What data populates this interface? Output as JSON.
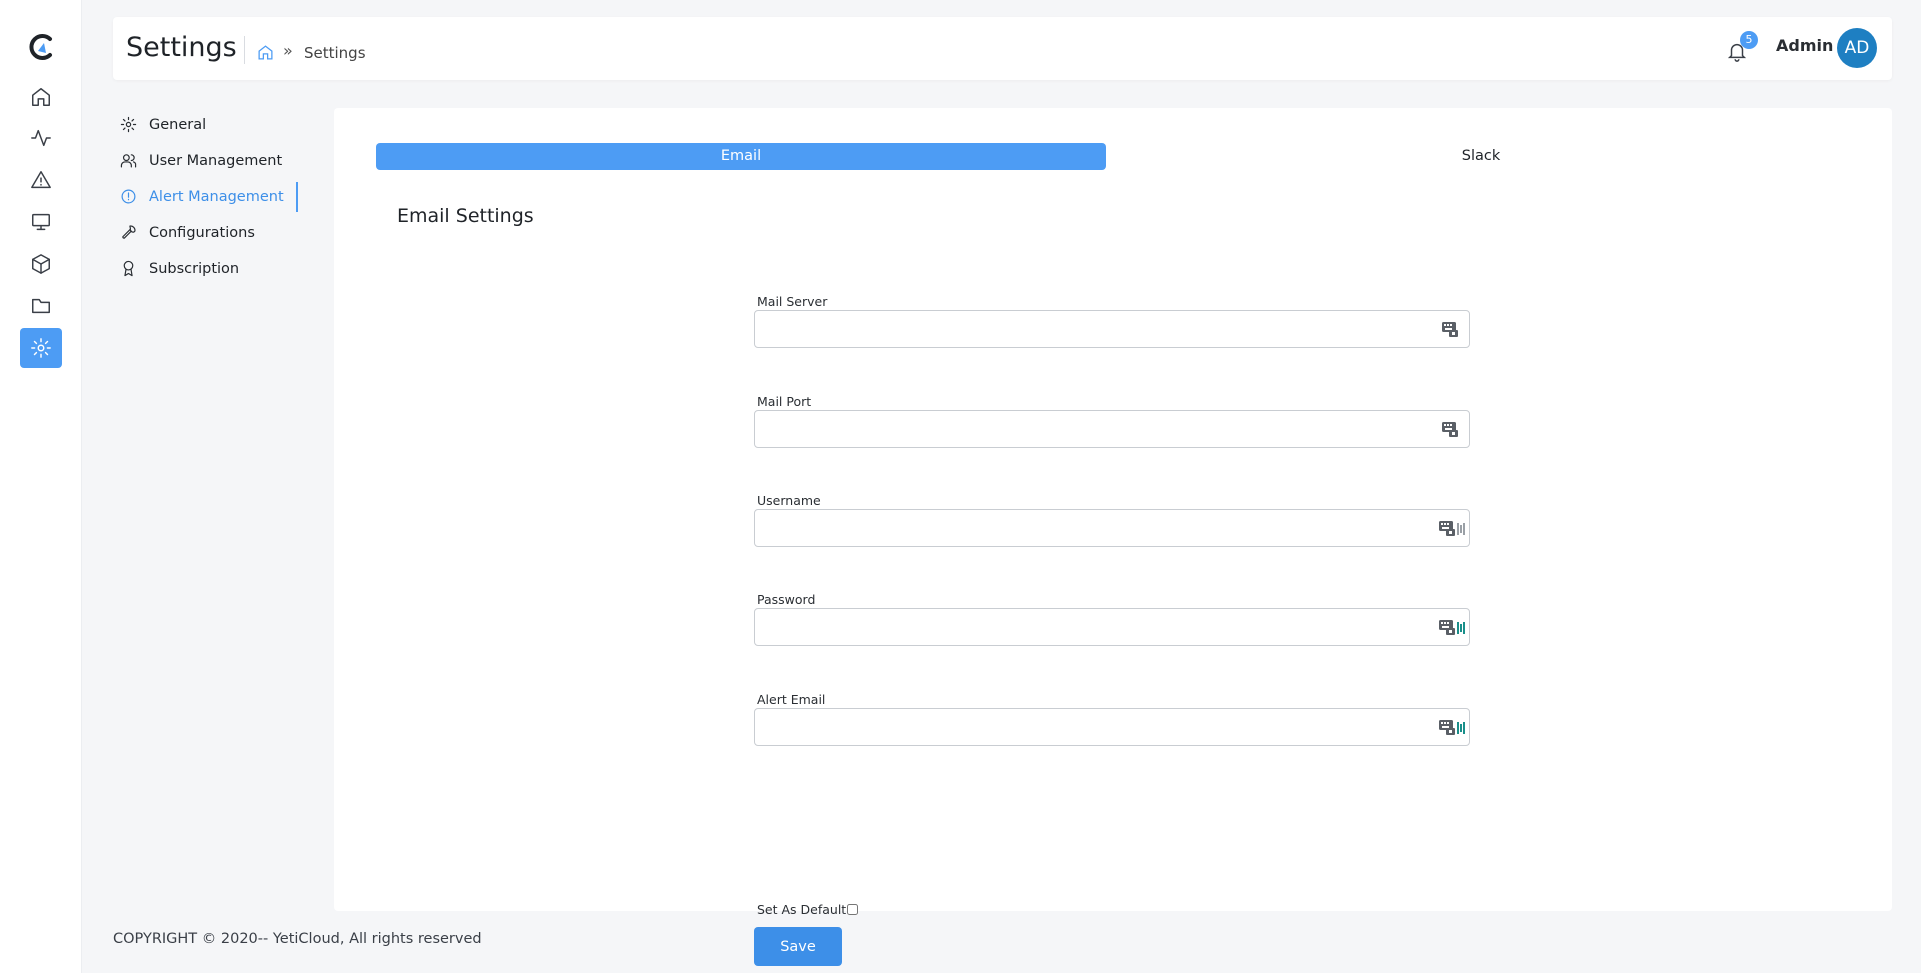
{
  "header": {
    "title": "Settings",
    "breadcrumb_sep": "»",
    "breadcrumb_current": "Settings",
    "notification_count": "5",
    "user_name": "Admin",
    "avatar_initials": "AD"
  },
  "rail": {
    "items": [
      {
        "icon": "home-icon"
      },
      {
        "icon": "activity-icon"
      },
      {
        "icon": "alert-triangle-icon"
      },
      {
        "icon": "monitor-icon"
      },
      {
        "icon": "box-icon"
      },
      {
        "icon": "folder-icon"
      },
      {
        "icon": "settings-icon",
        "active": true
      }
    ]
  },
  "subnav": {
    "items": [
      {
        "label": "General",
        "icon": "gear-icon"
      },
      {
        "label": "User Management",
        "icon": "users-icon"
      },
      {
        "label": "Alert Management",
        "icon": "alert-circle-icon",
        "active": true
      },
      {
        "label": "Configurations",
        "icon": "wrench-icon"
      },
      {
        "label": "Subscription",
        "icon": "award-icon"
      }
    ]
  },
  "tabs": [
    {
      "label": "Email",
      "active": true
    },
    {
      "label": "Slack",
      "active": false
    }
  ],
  "section_title": "Email Settings",
  "form": {
    "fields": [
      {
        "label": "Mail Server",
        "value": ""
      },
      {
        "label": "Mail Port",
        "value": ""
      },
      {
        "label": "Username",
        "value": ""
      },
      {
        "label": "Password",
        "value": ""
      },
      {
        "label": "Alert Email",
        "value": ""
      }
    ],
    "default_label": "Set As Default",
    "save_label": "Save"
  },
  "footer": {
    "copyright": "COPYRIGHT © 2020-- YetiCloud, All rights reserved"
  },
  "colors": {
    "accent": "#4d9cf4",
    "avatar": "#1e7fc2"
  }
}
